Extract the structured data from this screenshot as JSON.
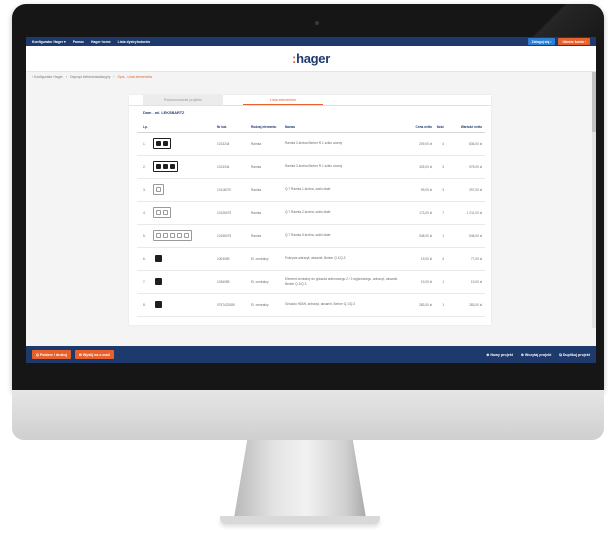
{
  "topbar": {
    "nav": [
      "Konfigurator Hager ▾",
      "Pomoc",
      "Hager home",
      "Lista dystrybutorów"
    ],
    "login": "Zaloguj się ›",
    "register": "Utwórz konto ›"
  },
  "logo": {
    "prefix": ":",
    "name": "hager"
  },
  "breadcrumb": {
    "items": [
      "‹ Konfigurator Hager",
      "›",
      "Osprzęt elektroinstalacyjny",
      "›"
    ],
    "active": "Opis - Lista elementów"
  },
  "tabs": {
    "first": "Podsumowanie projektu",
    "second": "Lista elementów"
  },
  "subtitle": "Dom - ml. LEKSBARTZ",
  "table": {
    "headers": [
      "Lp.",
      "",
      "Nr kat.",
      "Rodzaj elementu",
      "Nazwa",
      "Cena netto",
      "Ilość",
      "Wartość netto"
    ],
    "rows": [
      {
        "lp": "1.",
        "ref": "1013244",
        "type": "Ramka",
        "name": "Ramka 2-krotna Berker R.1 szkło czarny",
        "price": "209,00 zł",
        "qty": "4",
        "total": "836,00 zł"
      },
      {
        "lp": "2.",
        "ref": "1013344",
        "type": "Ramka",
        "name": "Ramka 3-krotna Berker R.1 szkło czarny",
        "price": "325,00 zł",
        "qty": "3",
        "total": "975,00 zł"
      },
      {
        "lp": "3.",
        "ref": "10116079",
        "type": "Ramka",
        "name": "Q.7 Ramka 1-krotna, szkło białe",
        "price": "99,00 zł",
        "qty": "3",
        "total": "297,00 zł"
      },
      {
        "lp": "4.",
        "ref": "10126079",
        "type": "Ramka",
        "name": "Q.7 Ramka 2-krotna, szkło białe",
        "price": "173,00 zł",
        "qty": "7",
        "total": "1 211,00 zł"
      },
      {
        "lp": "5.",
        "ref": "10156079",
        "type": "Ramka",
        "name": "Q.7 Ramka 5-krotna, szkło białe",
        "price": "548,00 zł",
        "qty": "1",
        "total": "548,00 zł"
      },
      {
        "lp": "6.",
        "ref": "1003089",
        "type": "El. centralny",
        "name": "Pokrywa antracyt, aksamit, Berker Q.1/Q.3",
        "price": "19,00 zł",
        "qty": "4",
        "total": "77,00 zł"
      },
      {
        "lp": "7.",
        "ref": "1036089",
        "type": "El. centralny",
        "name": "Element centralny do gniazda antenowego 2 / 3 wyjściowego, antracyt, aksamit, Berker Q.1/Q.3",
        "price": "19,00 zł",
        "qty": "1",
        "total": "19,00 zł"
      },
      {
        "lp": "8.",
        "ref": "0757422089",
        "type": "El. centralny",
        "name": "Gniazdo HDMI, antracyt, aksamit, Berker Q.1/Q.3",
        "price": "283,00 zł",
        "qty": "1",
        "total": "283,00 zł"
      }
    ]
  },
  "bottombar": {
    "print": "⎙ Pobierz / drukuj",
    "email": "✉ Wyślij na e-mail",
    "new_project": "⊕ Nowy projekt",
    "load_project": "⊕ Wczytaj projekt",
    "duplicate": "⧉ Duplikuj projekt"
  },
  "colors": {
    "navy": "#1e3a6d",
    "orange": "#e8602c",
    "blue": "#2a7fd4"
  }
}
